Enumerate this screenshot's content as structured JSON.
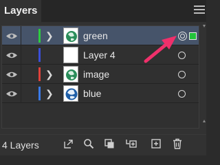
{
  "panel": {
    "title": "Layers",
    "layer_count": "4 Layers"
  },
  "layers": [
    {
      "name": "green",
      "color": "#2ecc40",
      "has_children": true,
      "selected": true,
      "thumb": "globe"
    },
    {
      "name": "Layer 4",
      "color": "#3b4fd8",
      "has_children": false,
      "selected": false,
      "thumb": "blank"
    },
    {
      "name": "image",
      "color": "#e0413b",
      "has_children": true,
      "selected": false,
      "thumb": "globe"
    },
    {
      "name": "blue",
      "color": "#3a7bea",
      "has_children": true,
      "selected": false,
      "thumb": "blue-globe"
    }
  ],
  "footer_buttons": [
    "export-icon",
    "search-icon",
    "clipping-mask-icon",
    "new-sublayer-icon",
    "new-layer-icon",
    "trash-icon"
  ],
  "colors": {
    "selection_row": "#46546a",
    "selected_art_indicator": "#22c33a",
    "annotation_arrow": "#f0306b"
  }
}
